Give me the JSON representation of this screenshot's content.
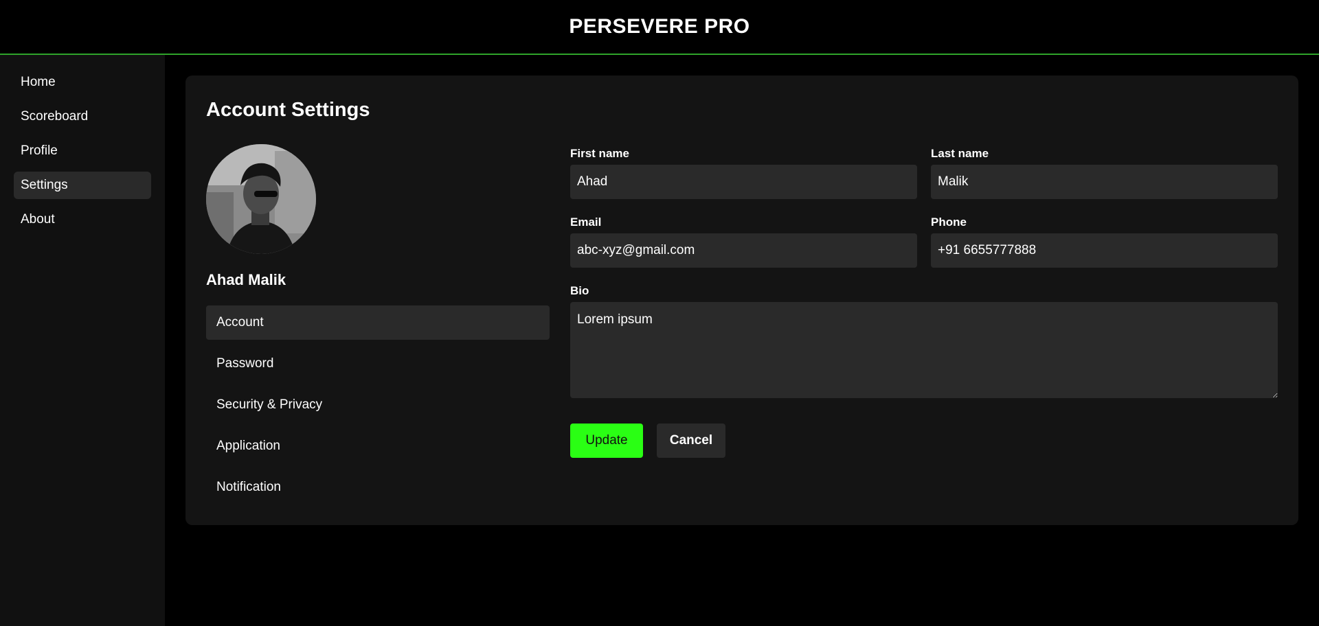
{
  "app": {
    "title": "PERSEVERE PRO"
  },
  "sidebar": {
    "items": [
      {
        "label": "Home"
      },
      {
        "label": "Scoreboard"
      },
      {
        "label": "Profile"
      },
      {
        "label": "Settings",
        "active": true
      },
      {
        "label": "About"
      }
    ]
  },
  "settings": {
    "title": "Account Settings",
    "user_name": "Ahad Malik",
    "menu": [
      {
        "label": "Account",
        "active": true
      },
      {
        "label": "Password"
      },
      {
        "label": "Security & Privacy"
      },
      {
        "label": "Application"
      },
      {
        "label": "Notification"
      }
    ]
  },
  "form": {
    "first_name": {
      "label": "First name",
      "value": "Ahad"
    },
    "last_name": {
      "label": "Last name",
      "value": "Malik"
    },
    "email": {
      "label": "Email",
      "value": "abc-xyz@gmail.com"
    },
    "phone": {
      "label": "Phone",
      "value": "+91 6655777888"
    },
    "bio": {
      "label": "Bio",
      "value": "Lorem ipsum"
    },
    "update_label": "Update",
    "cancel_label": "Cancel"
  },
  "colors": {
    "accent": "#2aff14",
    "header_border": "#2fa52a",
    "panel": "#141414",
    "input": "#2a2a2a"
  }
}
